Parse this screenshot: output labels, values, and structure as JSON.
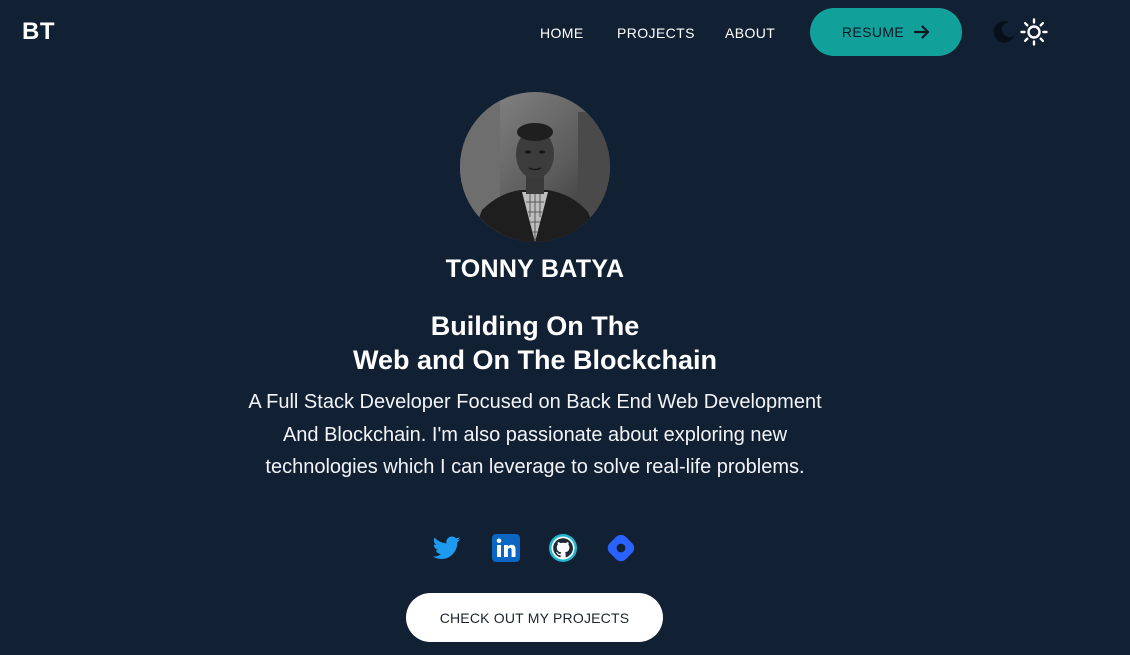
{
  "nav": {
    "logo": "BT",
    "links": [
      "HOME",
      "PROJECTS",
      "ABOUT"
    ],
    "resume_label": "RESUME",
    "resume_icon": "arrow-right-icon",
    "theme_icons": [
      "moon-icon",
      "sun-icon"
    ]
  },
  "hero": {
    "name": "TONNY BATYA",
    "headline_line1": "Building On The",
    "headline_line2": "Web and On The Blockchain",
    "bio_line1": "A Full Stack Developer Focused on Back End Web Development",
    "bio_line2": "And Blockchain. I'm also passionate about exploring new",
    "bio_line3": "technologies which I can leverage to solve real-life problems."
  },
  "social": {
    "icons": [
      "twitter-icon",
      "linkedin-icon",
      "github-icon",
      "hashnode-icon"
    ],
    "colors": {
      "twitter": "#1d9bf0",
      "linkedin": "#0a66c2",
      "github": "#22b8d1",
      "hashnode": "#2962ff"
    }
  },
  "cta": {
    "label": "CHECK OUT MY PROJECTS"
  },
  "colors": {
    "background": "#122034",
    "accent": "#12a19a"
  }
}
